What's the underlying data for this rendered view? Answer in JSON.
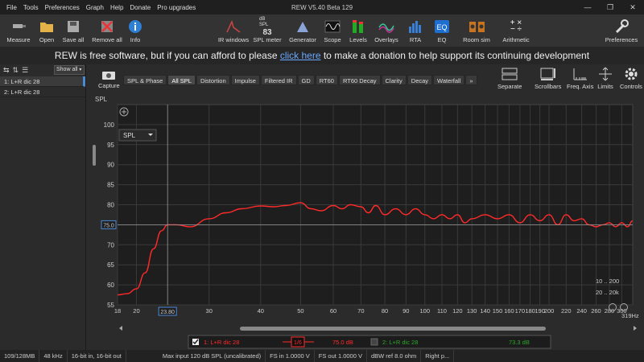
{
  "window": {
    "title": "REW V5.40 Beta 129",
    "menu": [
      "File",
      "Tools",
      "Preferences",
      "Graph",
      "Help",
      "Donate",
      "Pro upgrades"
    ]
  },
  "toolbar": {
    "left": [
      {
        "label": "Measure",
        "icon": "microphone-icon"
      },
      {
        "label": "Open",
        "icon": "folder-icon"
      },
      {
        "label": "Save all",
        "icon": "save-icon"
      },
      {
        "label": "Remove all",
        "icon": "remove-icon"
      },
      {
        "label": "Info",
        "icon": "info-icon"
      }
    ],
    "center": [
      {
        "label": "IR windows",
        "icon": "ir-windows-icon"
      },
      {
        "label": "SPL meter",
        "icon": "spl-meter-icon",
        "badge_top": "dB SPL",
        "badge_value": "83"
      },
      {
        "label": "Generator",
        "icon": "generator-icon"
      },
      {
        "label": "Scope",
        "icon": "scope-icon"
      },
      {
        "label": "Levels",
        "icon": "levels-icon"
      },
      {
        "label": "Overlays",
        "icon": "overlays-icon"
      },
      {
        "label": "RTA",
        "icon": "rta-icon"
      },
      {
        "label": "EQ",
        "icon": "eq-icon"
      },
      {
        "label": "Room sim",
        "icon": "room-sim-icon"
      },
      {
        "label": "Arithmetic",
        "icon": "arithmetic-icon"
      }
    ],
    "right": [
      {
        "label": "Preferences",
        "icon": "wrench-icon"
      }
    ]
  },
  "banner": {
    "before": "REW is free software, but if you can afford to please ",
    "link": "click here",
    "after": " to make a donation to help support its continuing development"
  },
  "measurements_panel": {
    "show_label": "Show all",
    "items": [
      {
        "label": "1: L+R dic 28",
        "selected": true
      },
      {
        "label": "2: L+R dic 28",
        "selected": false
      }
    ]
  },
  "graph_tabs": {
    "capture_label": "Capture",
    "tabs": [
      "SPL & Phase",
      "All SPL",
      "Distortion",
      "Impulse",
      "Filtered IR",
      "GD",
      "RT60",
      "RT60 Decay",
      "Clarity",
      "Decay",
      "Waterfall",
      "»"
    ],
    "active": "All SPL",
    "right_buttons": [
      {
        "label": "Separate",
        "icon": "separate-icon"
      },
      {
        "label": "Scrollbars",
        "icon": "scrollbars-icon"
      },
      {
        "label": "Freq. Axis",
        "icon": "freq-axis-icon"
      },
      {
        "label": "Limits",
        "icon": "limits-icon"
      },
      {
        "label": "Controls",
        "icon": "gear-icon"
      }
    ]
  },
  "chart_data": {
    "type": "line",
    "ylabel": "SPL",
    "y_unit_select": "SPL",
    "xlim": [
      18,
      319
    ],
    "x_scale": "log",
    "ylim": [
      55,
      105
    ],
    "yticks": [
      55,
      60,
      65,
      70,
      75,
      80,
      85,
      90,
      95,
      100
    ],
    "xticks": [
      18,
      20,
      30,
      40,
      50,
      60,
      70,
      80,
      90,
      100,
      110,
      120,
      130,
      140,
      150,
      160,
      170,
      180,
      190,
      200,
      220,
      240,
      260,
      280,
      300
    ],
    "xtick_labels": [
      "18",
      "20",
      "30",
      "40",
      "50",
      "60",
      "70",
      "80",
      "90",
      "100",
      "110",
      "120",
      "130",
      "140",
      "150",
      "160",
      "170",
      "180",
      "190",
      "200",
      "220",
      "240",
      "260",
      "280",
      "300"
    ],
    "x_end_label": "319Hz",
    "cursor": {
      "x_label": "23.80",
      "y_label": "75.0",
      "x": 23.8,
      "y": 75.0
    },
    "range_buttons": [
      "10 .. 200",
      "20 .. 20k"
    ],
    "grid": true,
    "series": [
      {
        "name": "1: L+R dic 28",
        "color": "#ff2a2a",
        "x": [
          18,
          19,
          20,
          21,
          22,
          23,
          23.8,
          25,
          27,
          30,
          33,
          36,
          40,
          43,
          46,
          50,
          53,
          56,
          60,
          63,
          66,
          70,
          73,
          76,
          80,
          85,
          90,
          95,
          100,
          105,
          110,
          115,
          120,
          125,
          130,
          140,
          150,
          160,
          170,
          180,
          190,
          200,
          210,
          220,
          230,
          240,
          250,
          260,
          270,
          280,
          290,
          300,
          310,
          319
        ],
        "y": [
          57.5,
          57.8,
          59,
          63,
          69,
          73.5,
          75,
          75,
          74.5,
          76.5,
          78,
          79,
          79.7,
          79.5,
          79.8,
          80.5,
          79,
          78.5,
          79.8,
          79,
          80,
          79.5,
          78,
          79.8,
          77.5,
          79,
          77.5,
          79,
          77.5,
          76.5,
          77.5,
          76.5,
          77.5,
          75.5,
          76.5,
          77.5,
          76.5,
          77.5,
          75.5,
          77.5,
          76,
          77.5,
          75,
          77.5,
          76,
          76.5,
          75,
          74.5,
          75,
          75.5,
          74.5,
          75.5,
          74.5,
          76
        ]
      }
    ]
  },
  "legend": {
    "rows": [
      {
        "checked": true,
        "name": "1: L+R dic 28",
        "color": "#ff2a2a",
        "smoothing": "1/6",
        "value": "75.0 dB"
      },
      {
        "checked": false,
        "name": "2: L+R dic 28",
        "color": "#2aa82a",
        "value": "73.3 dB"
      }
    ]
  },
  "statusbar": [
    "109/128MB",
    "48 kHz",
    "16-bit in, 16-bit out",
    "Max input 120 dB SPL (uncalibrated)",
    "FS in 1.0000 V",
    "FS out 1.0000 V",
    "dBW ref 8.0 ohm",
    "Right p..."
  ]
}
